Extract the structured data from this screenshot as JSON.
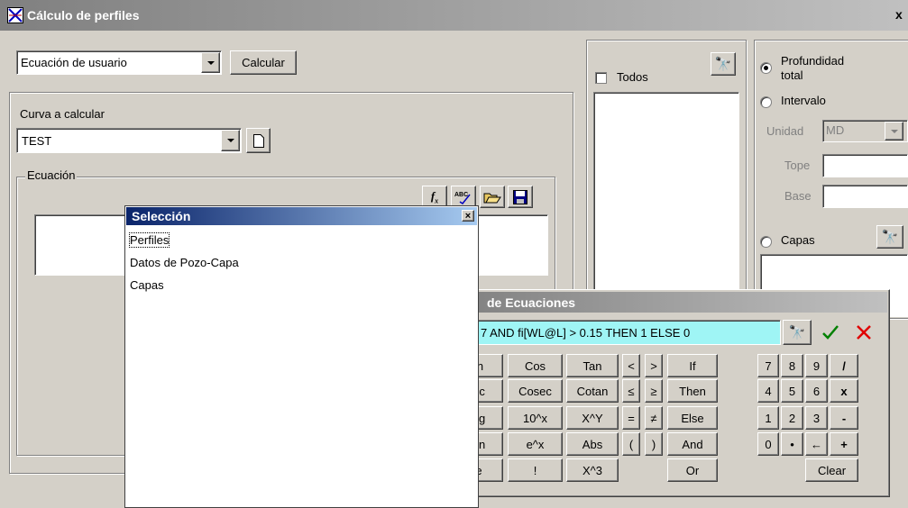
{
  "window": {
    "title": "Cálculo de perfiles",
    "close_label": "x"
  },
  "top": {
    "equation_type": "Ecuación de usuario",
    "calc_button": "Calcular"
  },
  "curve": {
    "label": "Curva a calcular",
    "value": "TEST"
  },
  "equation": {
    "group_label": "Ecuación"
  },
  "selection": {
    "title": "Selección",
    "close_label": "×",
    "items": [
      "Perfiles",
      "Datos de Pozo-Capa",
      "Capas"
    ]
  },
  "wells": {
    "todos_label": "Todos"
  },
  "range": {
    "profundidad_label_1": "Profundidad",
    "profundidad_label_2": "total",
    "intervalo_label": "Intervalo",
    "unidad_label": "Unidad",
    "unidad_value": "MD",
    "tope_label": "Tope",
    "base_label": "Base",
    "capas_label": "Capas"
  },
  "editor": {
    "title": "de Ecuaciones",
    "expression": "7 AND fi[WL@L] > 0.15 THEN 1 ELSE 0",
    "keys": {
      "r1": [
        "in",
        "Cos",
        "Tan",
        "<",
        ">",
        "If",
        "7",
        "8",
        "9",
        "/"
      ],
      "r2": [
        "ec",
        "Cosec",
        "Cotan",
        "≤",
        "≥",
        "Then",
        "4",
        "5",
        "6",
        "x"
      ],
      "r3": [
        "og",
        "10^x",
        "X^Y",
        "=",
        "≠",
        "Else",
        "1",
        "2",
        "3",
        "-"
      ],
      "r4": [
        "Ln",
        "e^x",
        "Abs",
        "(",
        ")",
        "And",
        "0",
        "•",
        "←",
        "+"
      ],
      "r5": [
        "e",
        "!",
        "X^3",
        "Or",
        "Clear"
      ]
    }
  },
  "colors": {
    "titlebar": "#808080",
    "selection_title": "#0a246a",
    "expression_bg": "#9ff5f5",
    "ok_green": "#008000",
    "cancel_red": "#e00000"
  }
}
